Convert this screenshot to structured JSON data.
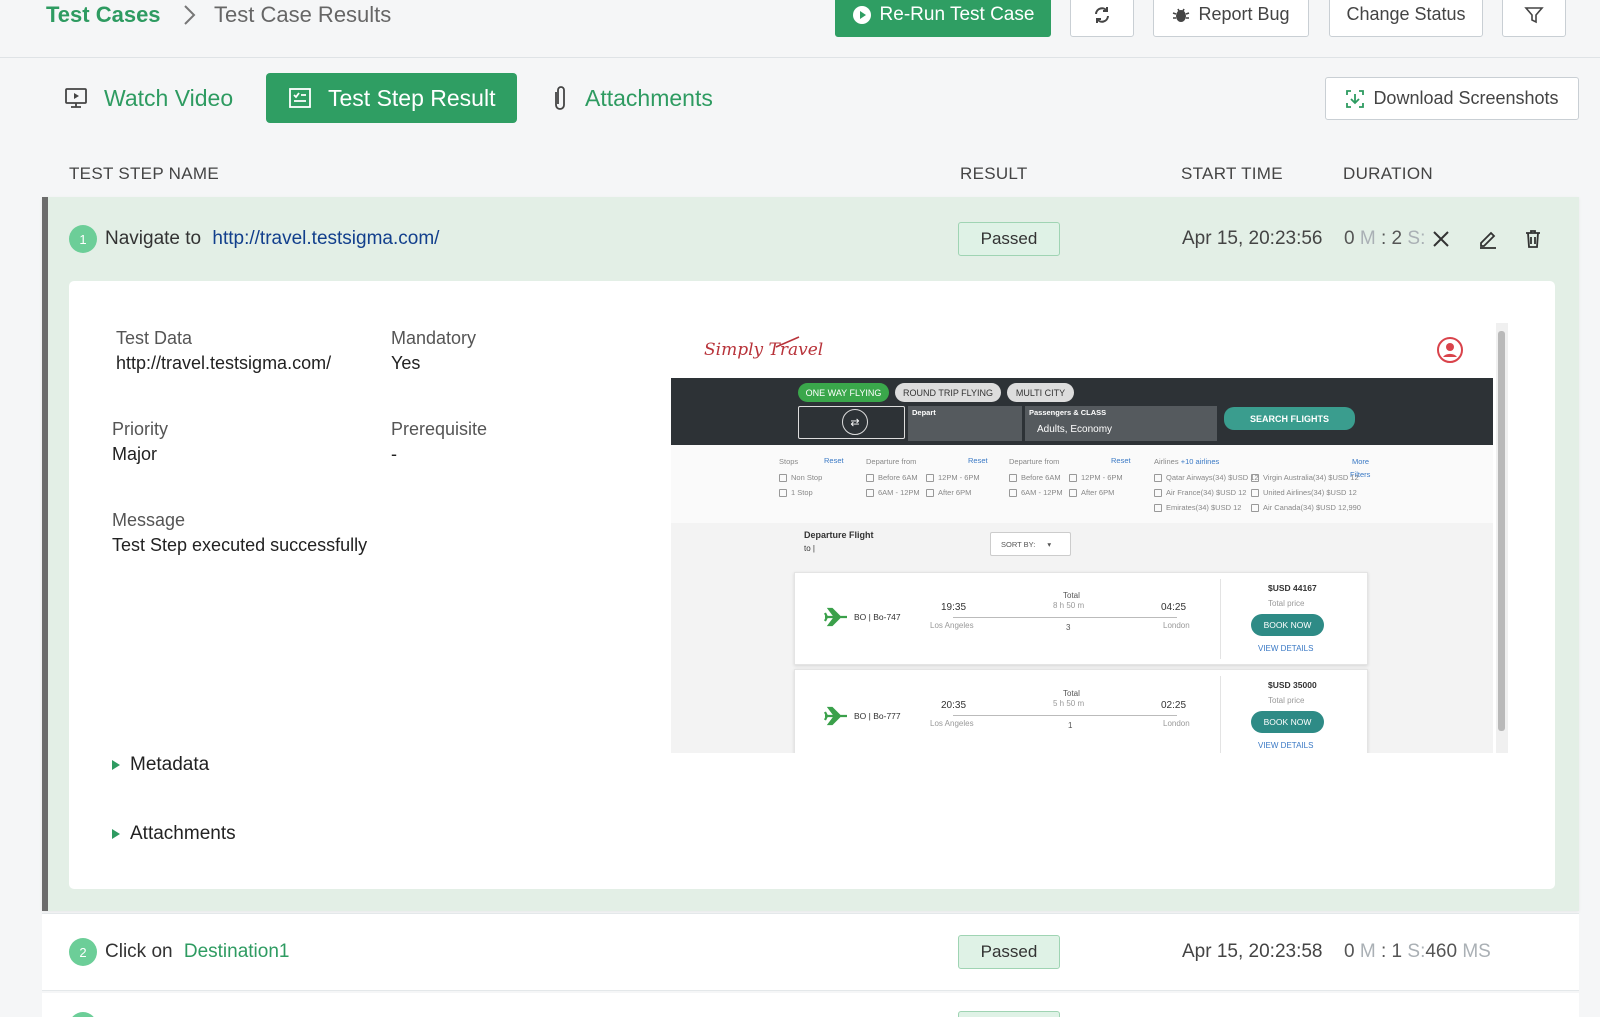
{
  "breadcrumb": {
    "root": "Test Cases",
    "current": "Test Case Results"
  },
  "toolbar": {
    "rerun": "Re-Run Test Case",
    "report_bug": "Report Bug",
    "change_status": "Change Status"
  },
  "tabs": {
    "watch_video": "Watch Video",
    "test_step_result": "Test Step Result",
    "attachments": "Attachments",
    "download": "Download Screenshots"
  },
  "columns": {
    "name": "TEST STEP NAME",
    "result": "RESULT",
    "start": "START TIME",
    "duration": "DURATION"
  },
  "steps": [
    {
      "num": "1",
      "action": "Navigate to",
      "target": "http://travel.testsigma.com/",
      "result": "Passed",
      "start": "Apr 15, 20:23:56",
      "dur_m_val": "0",
      "dur_m_unit": "M",
      "dur_sep": ":",
      "dur_s_val": "2",
      "dur_s_unit": "S:"
    },
    {
      "num": "2",
      "action": "Click on",
      "target": "Destination1",
      "result": "Passed",
      "start": "Apr 15, 20:23:58",
      "dur_m_val": "0",
      "dur_m_unit": "M",
      "dur_sep": ":",
      "dur_s_val": "1",
      "dur_s_unit": "S:",
      "dur_ms_val": "460",
      "dur_ms_unit": "MS"
    }
  ],
  "details": {
    "test_data_label": "Test Data",
    "test_data": "http://travel.testsigma.com/",
    "mandatory_label": "Mandatory",
    "mandatory": "Yes",
    "priority_label": "Priority",
    "priority": "Major",
    "prerequisite_label": "Prerequisite",
    "prerequisite": "-",
    "message_label": "Message",
    "message": "Test Step executed successfully",
    "metadata": "Metadata",
    "attachments": "Attachments"
  },
  "screenshot": {
    "logo": "Simply Travel",
    "pills": [
      "ONE WAY FLYING",
      "ROUND TRIP FLYING",
      "MULTI CITY"
    ],
    "depart": "Depart",
    "passengers_label": "Passengers & CLASS",
    "passengers": "Adults, Economy",
    "search": "SEARCH FLIGHTS",
    "filters": {
      "stops": "Stops",
      "reset": "Reset",
      "departure_from": "Departure from",
      "airlines": "Airlines",
      "more_airlines": "+10 airlines",
      "more": "More",
      "filters": "Filters",
      "non_stop": "Non Stop",
      "one_stop": "1 Stop",
      "before6": "Before 6AM",
      "six_to_12": "6AM - 12PM",
      "twelve_to_6": "12PM - 6PM",
      "after6": "After 6PM",
      "qatar": "Qatar Airways(34)  $USD 12",
      "virgin": "Virgin Australia(34)  $USD 12",
      "airfrance": "Air France(34)  $USD 12",
      "united": "United Airlines(34)  $USD 12",
      "emirates": "Emirates(34)  $USD 12",
      "aircanada": "Air Canada(34)  $USD 12,990"
    },
    "departure_flight": "Departure Flight",
    "to": "to |",
    "sort_by": "SORT BY:",
    "flights": [
      {
        "code": "BO | Bo-747",
        "dep": "19:35",
        "arr": "04:25",
        "from": "Los Angeles",
        "to": "London",
        "total": "Total",
        "duration": "8 h 50 m",
        "stops": "3",
        "price": "$USD 44167",
        "price_label": "Total price",
        "book": "BOOK NOW",
        "view": "VIEW DETAILS"
      },
      {
        "code": "BO | Bo-777",
        "dep": "20:35",
        "arr": "02:25",
        "from": "Los Angeles",
        "to": "London",
        "total": "Total",
        "duration": "5 h 50 m",
        "stops": "1",
        "price": "$USD 35000",
        "price_label": "Total price",
        "book": "BOOK NOW",
        "view": "VIEW DETAILS"
      }
    ]
  },
  "colors": {
    "brand": "#2f9e63",
    "link": "#123f8c",
    "badge_bg": "#dff2e6"
  }
}
